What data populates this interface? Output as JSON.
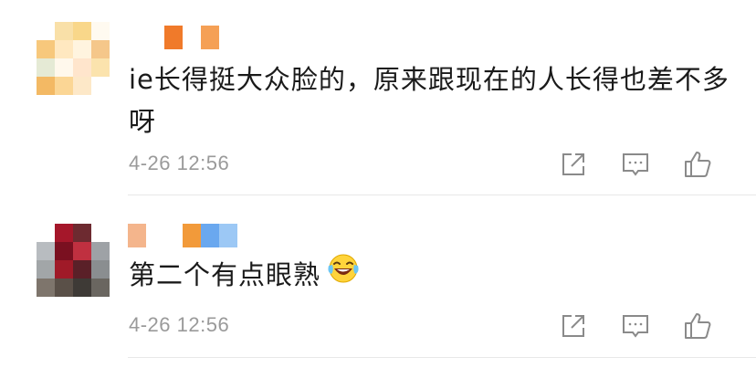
{
  "comments": [
    {
      "text": "ie长得挺大众脸的，原来跟现在的人长得也差不多呀",
      "time": "4-26 12:56",
      "avatar_colors": [
        "#ffffff",
        "#f9e0a8",
        "#f9d78a",
        "#fffaf0",
        "#f7c87c",
        "#ffe8c0",
        "#fff4df",
        "#f5c78a",
        "#e5ead5",
        "#fff8ec",
        "#ffe5cc",
        "#fbe3ad",
        "#f3b964",
        "#fbd695",
        "#fde8c8",
        "#ffffff"
      ],
      "name_colors": [
        "#ffffff",
        "#ffffff",
        "#f07a2a",
        "#ffffff",
        "#f5a055"
      ]
    },
    {
      "text": "第二个有点眼熟",
      "emoji": "laughing-crying-emoji",
      "time": "4-26 12:56",
      "avatar_colors": [
        "#ffffff",
        "#a5172a",
        "#6d2a30",
        "#ffffff",
        "#b8bcc0",
        "#7a1020",
        "#c03040",
        "#9ea2a6",
        "#a2a6a8",
        "#a01a28",
        "#5a2028",
        "#8a8e90",
        "#7e756c",
        "#5a5048",
        "#3e3a36",
        "#6a6660"
      ],
      "name_colors": [
        "#f4b58c",
        "#ffffff",
        "#ffffff",
        "#f29a3a",
        "#6aa8ef",
        "#9cc8f5"
      ]
    }
  ],
  "actions": [
    "share-icon",
    "comment-icon",
    "like-icon"
  ],
  "colors": {
    "text": "#1a1a1a",
    "time": "#9a9a9a",
    "icon": "#8a8a8a",
    "divider": "#e8e8e8"
  }
}
